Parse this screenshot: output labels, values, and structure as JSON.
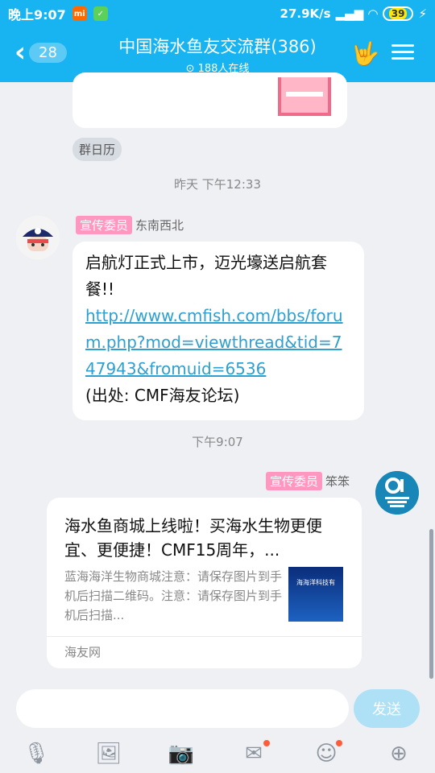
{
  "status_bar": {
    "time": "晚上9:07",
    "net_speed": "27.9K/s",
    "battery": "39"
  },
  "header": {
    "back_count": "28",
    "title": "中国海水鱼友交流群(386)",
    "online": "188人在线"
  },
  "messages": {
    "calendar_chip": "群日历",
    "timestamp_1": "昨天 下午12:33",
    "msg1": {
      "role": "宣传委员",
      "sender": "东南西北",
      "text_1": "启航灯正式上市，迈光壕送启航套餐!!",
      "link": "http://www.cmfish.com/bbs/forum.php?mod=viewthread&tid=747943&fromuid=6536",
      "text_2": "(出处: CMF海友论坛)"
    },
    "timestamp_2": "下午9:07",
    "msg2": {
      "role": "宣传委员",
      "sender": "笨笨",
      "share_title": "海水鱼商城上线啦！买海水生物更便宜、更便捷！CMF15周年，...",
      "share_desc": "蓝海海洋生物商城注意：请保存图片到手机后扫描二维码。注意：请保存图片到手机后扫描...",
      "thumb_text": "海海洋科技有",
      "source": "海友网"
    }
  },
  "input": {
    "send_label": "发送"
  },
  "toolbar": {
    "items": [
      "mic-icon",
      "image-icon",
      "camera-icon",
      "redpacket-icon",
      "emoji-icon",
      "plus-icon"
    ]
  }
}
